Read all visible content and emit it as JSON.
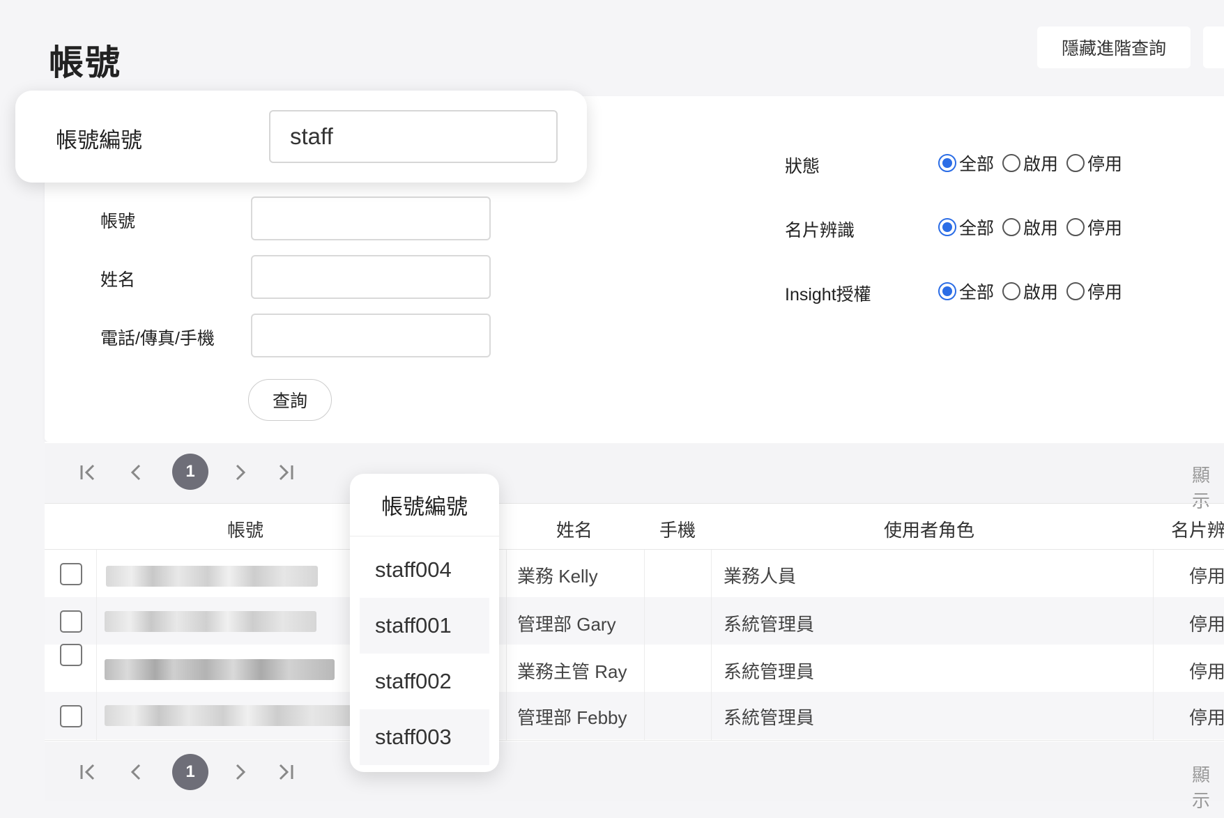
{
  "header": {
    "title": "帳號",
    "hide_advanced_button": "隱藏進階查詢"
  },
  "highlight_field": {
    "label": "帳號編號",
    "value": "staff"
  },
  "filters": {
    "account_label": "帳號",
    "name_label": "姓名",
    "phone_label": "電話/傳真/手機",
    "search_button": "查詢",
    "status": {
      "label": "狀態",
      "options": [
        "全部",
        "啟用",
        "停用"
      ],
      "selected": "全部"
    },
    "card_recognition": {
      "label": "名片辨識",
      "options": [
        "全部",
        "啟用",
        "停用"
      ],
      "selected": "全部"
    },
    "insight": {
      "label": "Insight授權",
      "options": [
        "全部",
        "啟用",
        "停用"
      ],
      "selected": "全部"
    }
  },
  "pager": {
    "current_page": "1",
    "show_text": "顯示"
  },
  "table": {
    "columns": [
      "帳號",
      "姓名",
      "手機",
      "使用者角色",
      "名片辨"
    ],
    "rows": [
      {
        "name": "業務 Kelly",
        "role": "業務人員",
        "card": "停用"
      },
      {
        "name": "管理部 Gary",
        "role": "系統管理員",
        "card": "停用"
      },
      {
        "name": "業務主管 Ray",
        "role": "系統管理員",
        "card": "停用"
      },
      {
        "name": "管理部 Febby",
        "role": "系統管理員",
        "card": "停用"
      }
    ]
  },
  "popover": {
    "header": "帳號編號",
    "items": [
      "staff004",
      "staff001",
      "staff002",
      "staff003"
    ]
  },
  "colors": {
    "accent": "#2b6de6",
    "page_bg": "#f5f5f7",
    "current_page_bg": "#6e6e78"
  },
  "icons": {
    "first": "first-page-icon",
    "prev": "prev-page-icon",
    "next": "next-page-icon",
    "last": "last-page-icon"
  }
}
